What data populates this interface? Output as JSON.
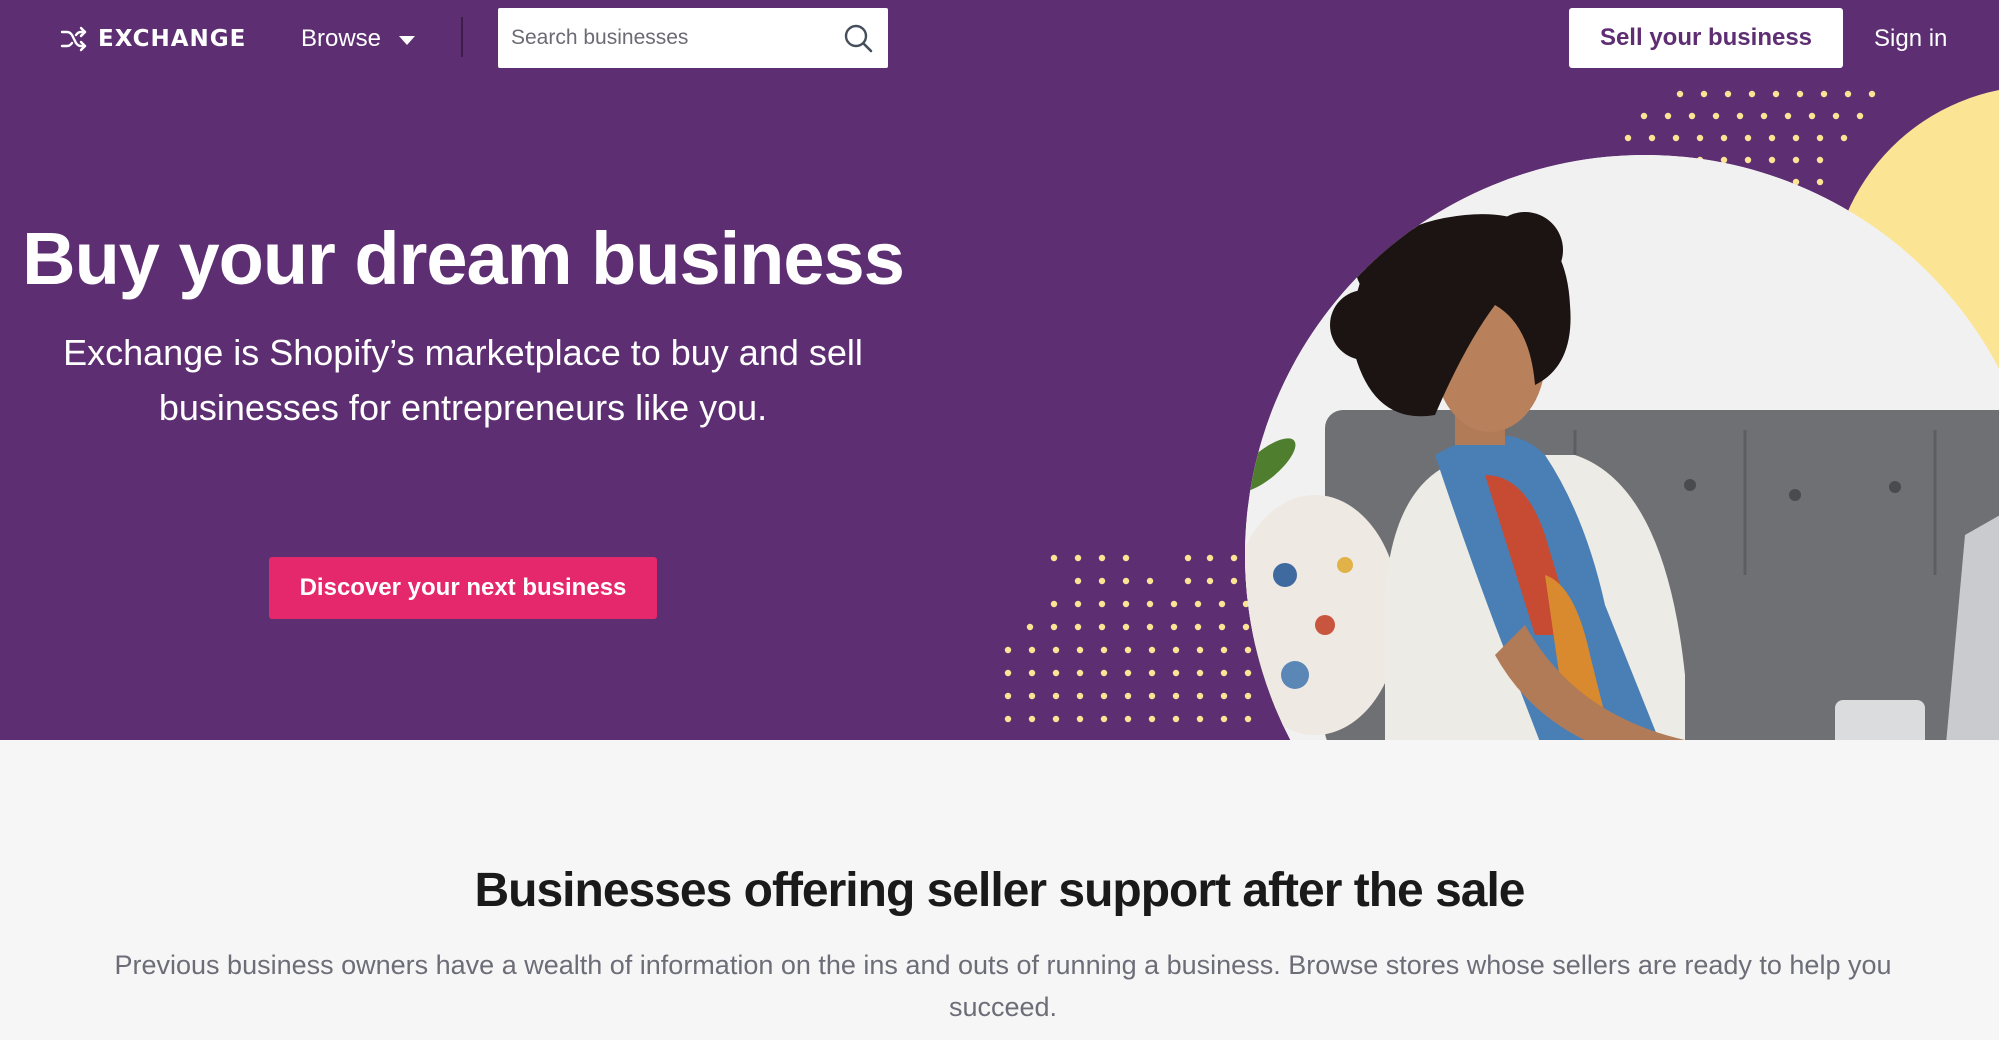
{
  "nav": {
    "logo_text": "EXCHANGE",
    "logo_icon": "shuffle-icon",
    "browse_label": "Browse",
    "search": {
      "placeholder": "Search businesses",
      "value": ""
    },
    "sell_label": "Sell your business",
    "signin_label": "Sign in"
  },
  "hero": {
    "title": "Buy your dream business",
    "subtitle": "Exchange is Shopify’s marketplace to buy and sell businesses for entrepreneurs like you.",
    "cta_label": "Discover your next business",
    "image": "photo of woman on sofa using laptop"
  },
  "section": {
    "title": "Businesses offering seller support after the sale",
    "text": "Previous business owners have a wealth of information on the ins and outs of running a business. Browse stores whose sellers are ready to help you succeed."
  },
  "colors": {
    "hero_bg": "#5e2e73",
    "cta": "#e5276b",
    "accent_yellow": "#fbe594",
    "page_bg": "#f6f6f7"
  }
}
